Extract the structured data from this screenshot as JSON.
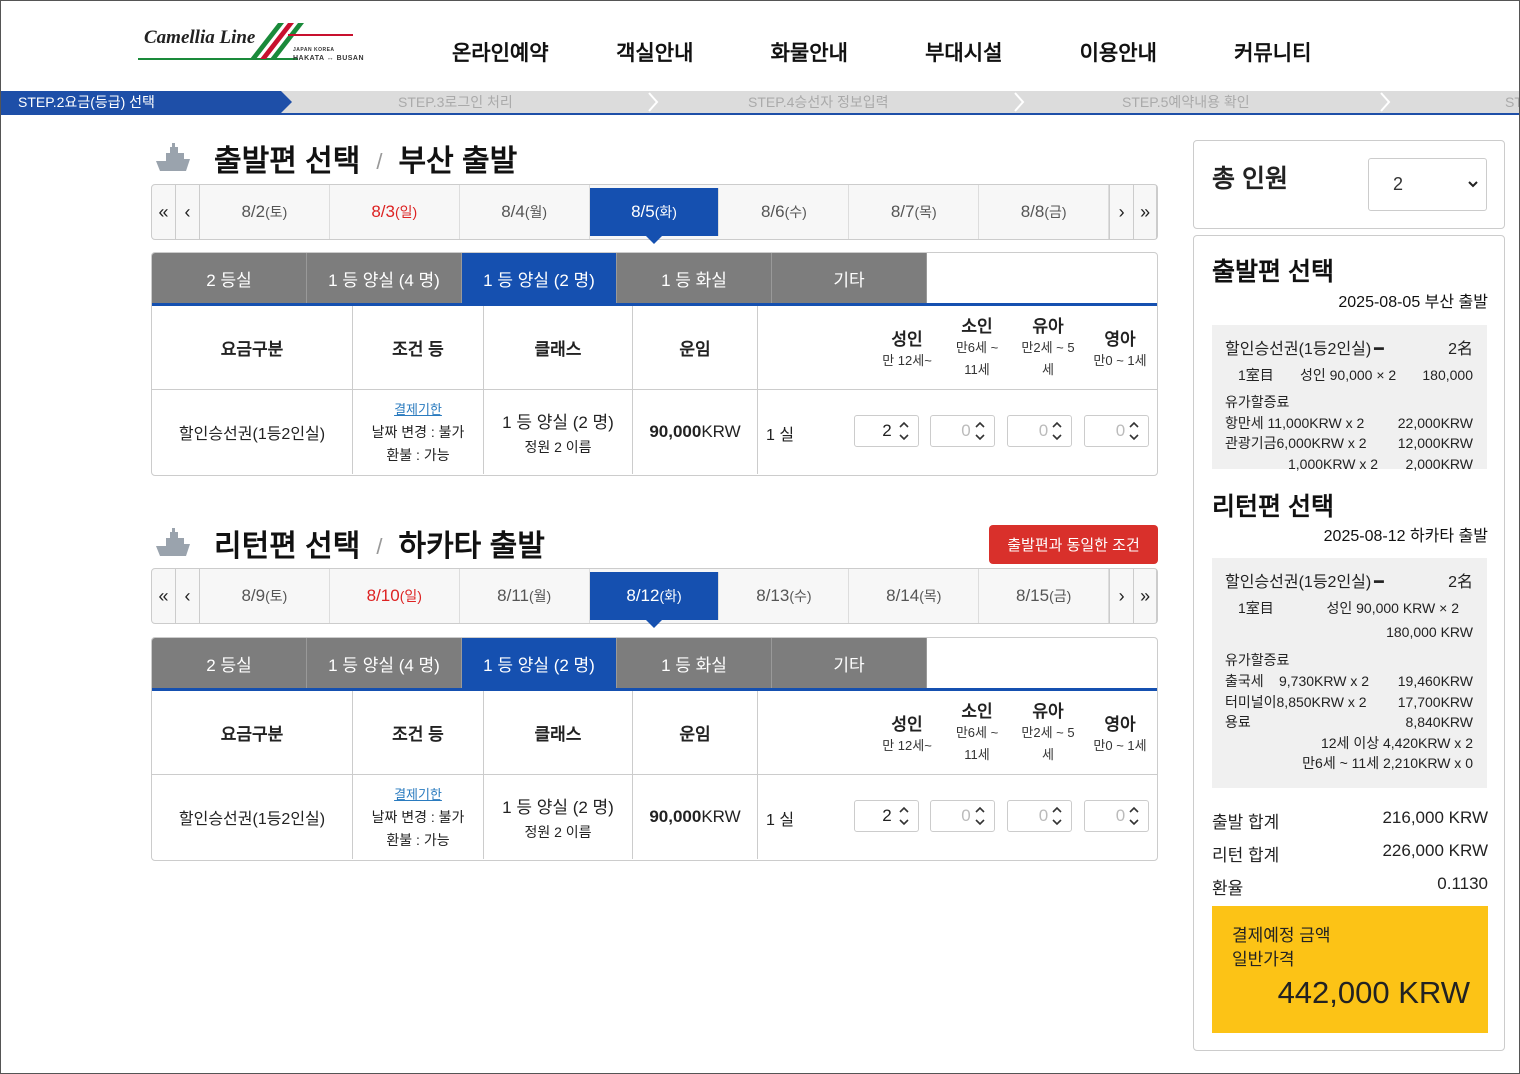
{
  "header": {
    "logo_text": "Camellia Line",
    "logo_sub": "HAKATA ↔ BUSAN",
    "logo_tiny": "JAPAN    KOREA",
    "nav": [
      "온라인예약",
      "객실안내",
      "화물안내",
      "부대시설",
      "이용안내",
      "커뮤니티"
    ]
  },
  "steps": {
    "active": "STEP.2요금(등급) 선택",
    "s3": "STEP.3로그인 처리",
    "s4": "STEP.4승선자 정보입력",
    "s5": "STEP.5예약내용 확인",
    "s6": "ST"
  },
  "outbound": {
    "title": "출발편 선택",
    "sep": "/",
    "sub": "부산 출발",
    "dates": [
      {
        "d": "8/2",
        "w": "(토)"
      },
      {
        "d": "8/3",
        "w": "(일)"
      },
      {
        "d": "8/4",
        "w": "(월)"
      },
      {
        "d": "8/5",
        "w": "(화)"
      },
      {
        "d": "8/6",
        "w": "(수)"
      },
      {
        "d": "8/7",
        "w": "(목)"
      },
      {
        "d": "8/8",
        "w": "(금)"
      }
    ],
    "tabs": [
      "2 등실",
      "1 등 양실 (4 명)",
      "1 등 양실 (2 명)",
      "1 등 화실",
      "기타"
    ],
    "head": {
      "h1": "요금구분",
      "h2": "조건 등",
      "h3": "클래스",
      "h4": "운임",
      "adult": "성인",
      "adult_s": "만 12세~",
      "child": "소인",
      "child_s1": "만6세 ~",
      "child_s2": "11세",
      "inf": "유아",
      "inf_s1": "만2세 ~ 5",
      "inf_s2": "세",
      "baby": "영아",
      "baby_s": "만0 ~ 1세"
    },
    "row": {
      "type": "할인승선권(1등2인실)",
      "link": "결제기한",
      "cond1": "날짜 변경 : 불가",
      "cond2": "환불 : 가능",
      "cls1": "1 등 양실 (2 명)",
      "cls2": "정원 2 이름",
      "fare": "90,000",
      "cur": "KRW",
      "room": "1 실",
      "adult": "2",
      "child": "0",
      "inf": "0",
      "baby": "0"
    }
  },
  "inbound": {
    "title": "리턴편 선택",
    "sep": "/",
    "sub": "하카타 출발",
    "same_btn": "출발편과 동일한 조건",
    "dates": [
      {
        "d": "8/9",
        "w": "(토)"
      },
      {
        "d": "8/10",
        "w": "(일)"
      },
      {
        "d": "8/11",
        "w": "(월)"
      },
      {
        "d": "8/12",
        "w": "(화)"
      },
      {
        "d": "8/13",
        "w": "(수)"
      },
      {
        "d": "8/14",
        "w": "(목)"
      },
      {
        "d": "8/15",
        "w": "(금)"
      }
    ],
    "tabs": [
      "2 등실",
      "1 등 양실 (4 명)",
      "1 등 양실 (2 명)",
      "1 등 화실",
      "기타"
    ],
    "head": {
      "h1": "요금구분",
      "h2": "조건 등",
      "h3": "클래스",
      "h4": "운임",
      "adult": "성인",
      "adult_s": "만 12세~",
      "child": "소인",
      "child_s1": "만6세 ~",
      "child_s2": "11세",
      "inf": "유아",
      "inf_s1": "만2세 ~ 5",
      "inf_s2": "세",
      "baby": "영아",
      "baby_s": "만0 ~ 1세"
    },
    "row": {
      "type": "할인승선권(1등2인실)",
      "link": "결제기한",
      "cond1": "날짜 변경 : 불가",
      "cond2": "환불 : 가능",
      "cls1": "1 등 양실 (2 명)",
      "cls2": "정원 2 이름",
      "fare": "90,000",
      "cur": "KRW",
      "room": "1 실",
      "adult": "2",
      "child": "0",
      "inf": "0",
      "baby": "0"
    }
  },
  "sidebar": {
    "total_label": "총 인원",
    "total_value": "2",
    "out": {
      "h": "출발편 선택",
      "date": "2025-08-05 부산 출발",
      "ticket": "할인승선권(1등2인실)",
      "dash": "━",
      "cnt": "2名",
      "room": "1室目",
      "calc": "성인 90,000 × 2",
      "calc_amt": "180,000",
      "oil": "유가할증료",
      "l1": "항만세 11,000KRW x 2",
      "l1a": "22,000KRW",
      "l2": "관광기금6,000KRW x 2",
      "l2a": "12,000KRW",
      "l3": "1,000KRW x 2",
      "l3a": "2,000KRW"
    },
    "ret": {
      "h": "리턴편 선택",
      "date": "2025-08-12 하카타 출발",
      "ticket": "할인승선권(1등2인실)",
      "dash": "━",
      "cnt": "2名",
      "room": "1室目",
      "calc": "성인 90,000 KRW × 2",
      "calc_amt": "180,000 KRW",
      "oil": "유가할증료",
      "l1": "출국세",
      "l1b": "9,730KRW x 2",
      "l1a": "19,460KRW",
      "l2": "터미널이8,850KRW x 2",
      "l2a": "17,700KRW",
      "l3": "용료",
      "l3a": "8,840KRW",
      "l4": "12세 이상 4,420KRW x 2",
      "l5": "만6세 ~ 11세 2,210KRW x 0"
    },
    "out_total_l": "출발 합계",
    "out_total": "216,000 KRW",
    "ret_total_l": "리턴 합계",
    "ret_total": "226,000 KRW",
    "rate_l": "환율",
    "rate": "0.1130",
    "pay_l1": "결제예정 금액",
    "pay_l2": "일반가격",
    "pay_amt": "442,000 KRW"
  },
  "colors": {
    "primary": "#1550b0",
    "tab_gray": "#7d7d7d",
    "red": "#d9302b",
    "yellow": "#fcc316"
  }
}
